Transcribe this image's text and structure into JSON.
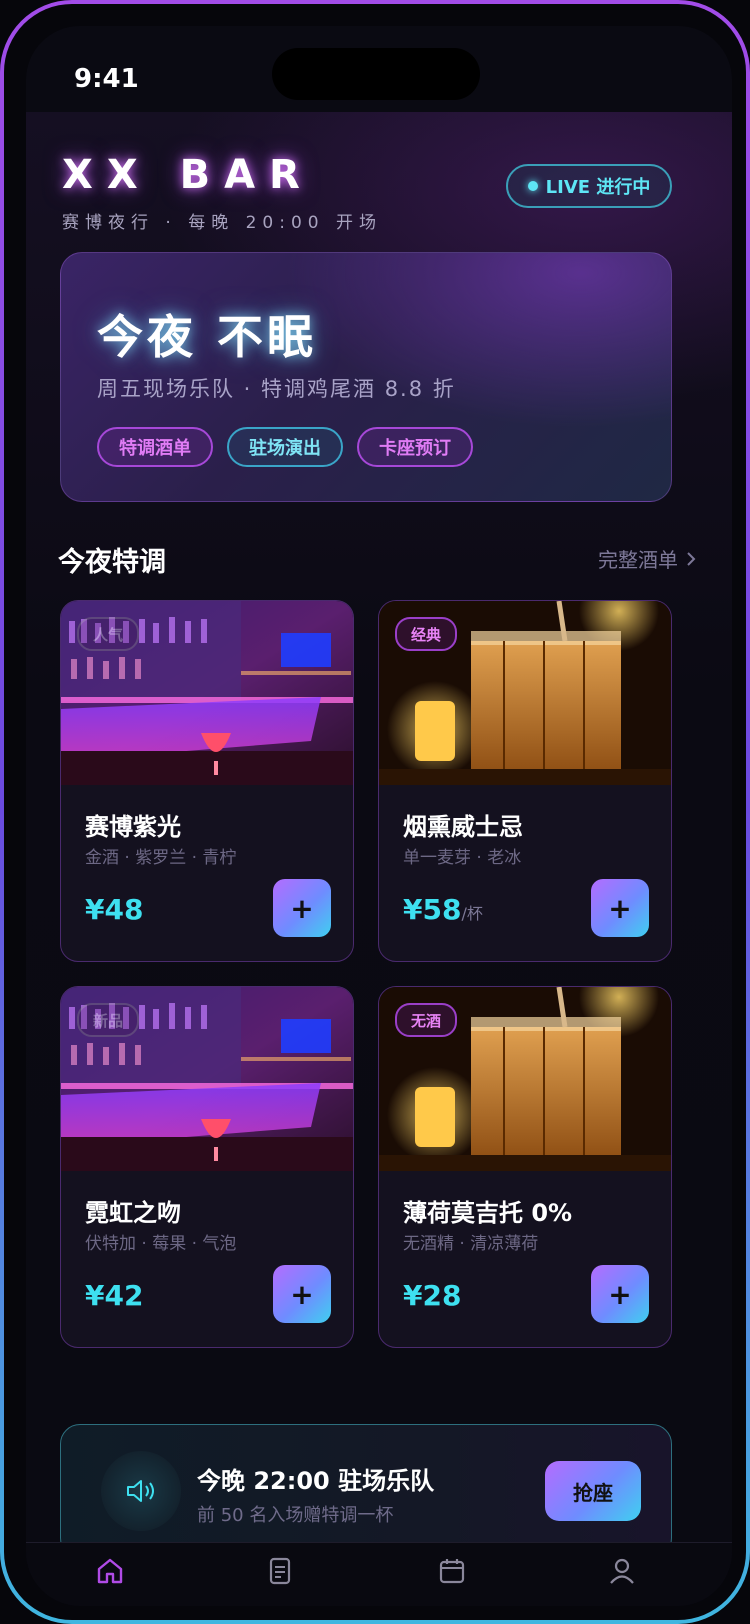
{
  "status": {
    "time": "9:41"
  },
  "header": {
    "brand": "XX BAR",
    "tagline": "赛博夜行 · 每晚 20:00 开场",
    "live_label": "LIVE 进行中"
  },
  "hero": {
    "title": "今夜 不眠",
    "subtitle": "周五现场乐队 · 特调鸡尾酒 8.8 折",
    "chips": [
      "特调酒单",
      "驻场演出",
      "卡座预订"
    ]
  },
  "section": {
    "title": "今夜特调",
    "link": "完整酒单"
  },
  "drinks": [
    {
      "badge": "人气",
      "name": "赛博紫光",
      "desc": "金酒 · 紫罗兰 · 青柠",
      "price": "¥48",
      "unit": "",
      "add": "+"
    },
    {
      "badge": "经典",
      "name": "烟熏威士忌",
      "desc": "单一麦芽 · 老冰",
      "price": "¥58",
      "unit": "/杯",
      "add": "+"
    },
    {
      "badge": "新品",
      "name": "霓虹之吻",
      "desc": "伏特加 · 莓果 · 气泡",
      "price": "¥42",
      "unit": "",
      "add": "+"
    },
    {
      "badge": "无酒",
      "name": "薄荷莫吉托 0%",
      "desc": "无酒精 · 清凉薄荷",
      "price": "¥28",
      "unit": "",
      "add": "+"
    }
  ],
  "banner": {
    "title": "今晚 22:00 驻场乐队",
    "subtitle": "前 50 名入场赠特调一杯",
    "button": "抢座"
  },
  "tabbar": {
    "items": [
      "home-icon",
      "menu-icon",
      "calendar-icon",
      "profile-icon"
    ],
    "active_color": "#b04be6",
    "inactive_color": "#8a879b"
  },
  "colors": {
    "accent_cyan": "#3ee0f0",
    "accent_purple": "#b46cff",
    "card_border": "#4a2a6e"
  }
}
